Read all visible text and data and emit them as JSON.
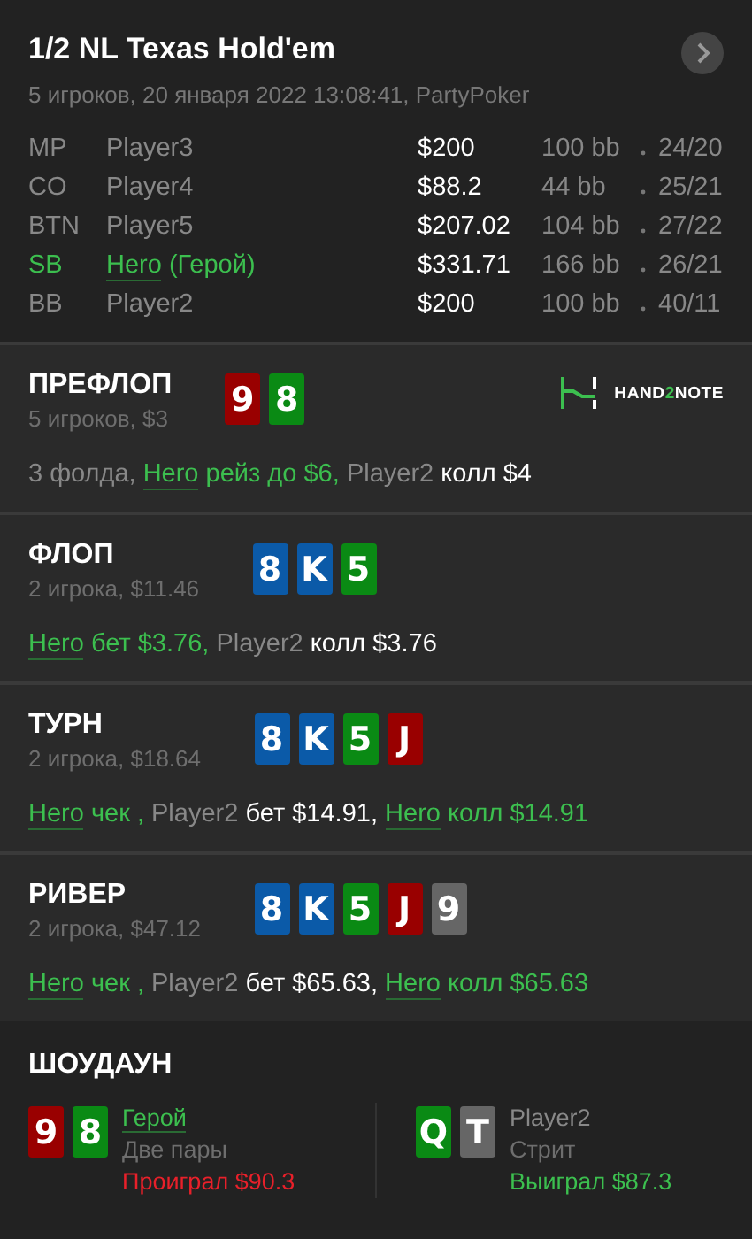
{
  "header": {
    "title": "1/2 NL Texas Hold'em",
    "subtitle": "5 игроков, 20 января 2022 13:08:41, PartyPoker",
    "players": [
      {
        "position": "MP",
        "name": "Player3",
        "hero": false,
        "stack": "$200",
        "bb": "100 bb",
        "stats": "24/20"
      },
      {
        "position": "CO",
        "name": "Player4",
        "hero": false,
        "stack": "$88.2",
        "bb": "44 bb",
        "stats": "25/21"
      },
      {
        "position": "BTN",
        "name": "Player5",
        "hero": false,
        "stack": "$207.02",
        "bb": "104 bb",
        "stats": "27/22"
      },
      {
        "position": "SB",
        "name": "Hero",
        "name_note": "(Герой)",
        "hero": true,
        "stack": "$331.71",
        "bb": "166 bb",
        "stats": "26/21"
      },
      {
        "position": "BB",
        "name": "Player2",
        "hero": false,
        "stack": "$200",
        "bb": "100 bb",
        "stats": "40/11"
      }
    ]
  },
  "streets": [
    {
      "title": "ПРЕФЛОП",
      "info": "5 игроков, $3",
      "cards": [
        {
          "rank": "9",
          "color": "#990000"
        },
        {
          "rank": "8",
          "color": "#0a8a14"
        }
      ],
      "logo": {
        "before": "HAND",
        "accent": "2",
        "after": "NOTE"
      },
      "actions": [
        {
          "kind": "plain",
          "text": "3 фолда, "
        },
        {
          "kind": "hero_name",
          "text": "Hero"
        },
        {
          "kind": "hero",
          "text": " рейз до $6, "
        },
        {
          "kind": "plain",
          "text": "Player2"
        },
        {
          "kind": "white",
          "text": " колл $4"
        }
      ]
    },
    {
      "title": "ФЛОП",
      "info": "2 игрока, $11.46",
      "cards": [
        {
          "rank": "8",
          "color": "#0b5aa8"
        },
        {
          "rank": "K",
          "color": "#0b5aa8"
        },
        {
          "rank": "5",
          "color": "#0a8a14"
        }
      ],
      "actions": [
        {
          "kind": "hero_name",
          "text": "Hero"
        },
        {
          "kind": "hero",
          "text": " бет $3.76, "
        },
        {
          "kind": "plain",
          "text": "Player2"
        },
        {
          "kind": "white",
          "text": " колл $3.76"
        }
      ]
    },
    {
      "title": "ТУРН",
      "info": "2 игрока, $18.64",
      "cards": [
        {
          "rank": "8",
          "color": "#0b5aa8"
        },
        {
          "rank": "K",
          "color": "#0b5aa8"
        },
        {
          "rank": "5",
          "color": "#0a8a14"
        },
        {
          "rank": "J",
          "color": "#990000"
        }
      ],
      "actions": [
        {
          "kind": "hero_name",
          "text": "Hero"
        },
        {
          "kind": "hero",
          "text": " чек , "
        },
        {
          "kind": "plain",
          "text": "Player2"
        },
        {
          "kind": "white",
          "text": " бет $14.91, "
        },
        {
          "kind": "hero_name",
          "text": "Hero"
        },
        {
          "kind": "hero",
          "text": " колл $14.91"
        }
      ]
    },
    {
      "title": "РИВЕР",
      "info": "2 игрока, $47.12",
      "cards": [
        {
          "rank": "8",
          "color": "#0b5aa8"
        },
        {
          "rank": "K",
          "color": "#0b5aa8"
        },
        {
          "rank": "5",
          "color": "#0a8a14"
        },
        {
          "rank": "J",
          "color": "#990000"
        },
        {
          "rank": "9",
          "color": "#666666"
        }
      ],
      "actions": [
        {
          "kind": "hero_name",
          "text": "Hero"
        },
        {
          "kind": "hero",
          "text": " чек , "
        },
        {
          "kind": "plain",
          "text": "Player2"
        },
        {
          "kind": "white",
          "text": " бет $65.63, "
        },
        {
          "kind": "hero_name",
          "text": "Hero"
        },
        {
          "kind": "hero",
          "text": " колл $65.63"
        }
      ]
    }
  ],
  "showdown": {
    "title": "ШОУДАУН",
    "hands": [
      {
        "name": "Герой",
        "hero": true,
        "combo": "Две пары",
        "result": "Проиграл $90.3",
        "won": false,
        "cards": [
          {
            "rank": "9",
            "color": "#990000"
          },
          {
            "rank": "8",
            "color": "#0a8a14"
          }
        ]
      },
      {
        "name": "Player2",
        "hero": false,
        "combo": "Стрит",
        "result": "Выиграл $87.3",
        "won": true,
        "cards": [
          {
            "rank": "Q",
            "color": "#0a8a14"
          },
          {
            "rank": "T",
            "color": "#666666"
          }
        ]
      }
    ]
  }
}
